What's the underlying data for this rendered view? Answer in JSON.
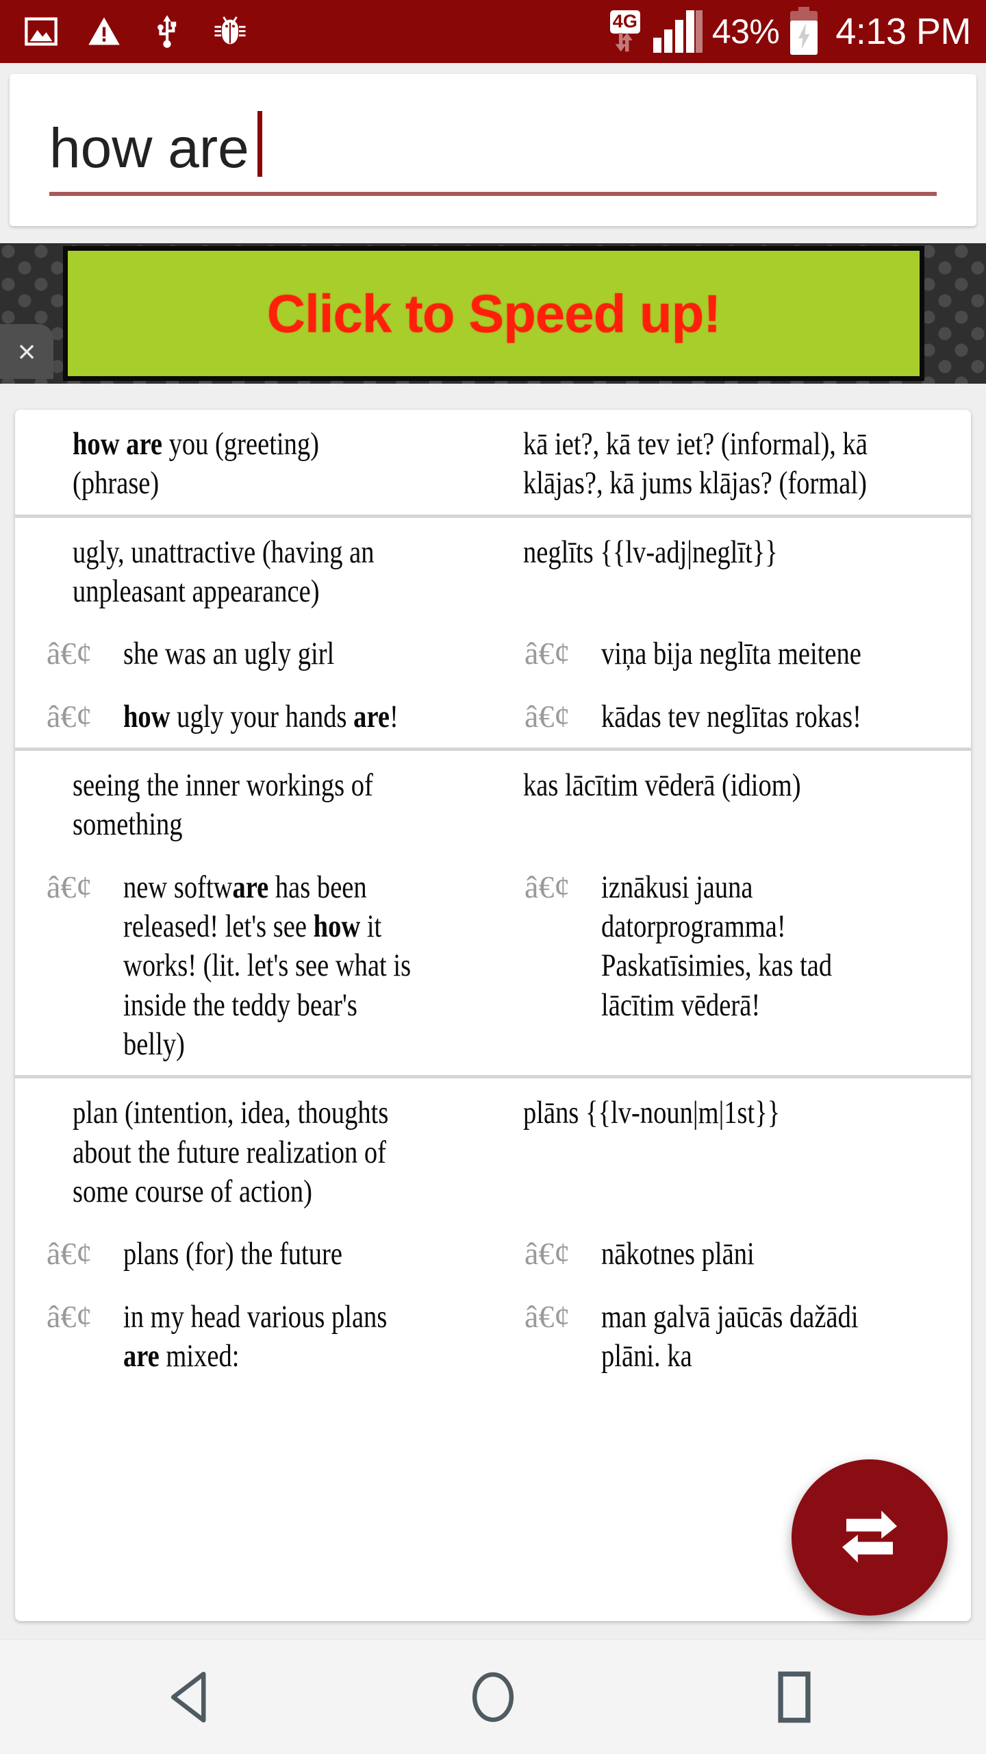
{
  "status_bar": {
    "background_color": "#8a0707",
    "left_icons": [
      "image-icon",
      "warning-triangle-icon",
      "usb-icon",
      "bug-icon"
    ],
    "network_type": "4G",
    "data_arrows_icon": "data-transfer-arrows-icon",
    "signal_icon": "signal-bars-icon",
    "battery_percent": "43%",
    "battery_icon": "battery-charging-icon",
    "clock": "4:13 PM"
  },
  "search": {
    "value": "how are",
    "placeholder": "",
    "caret_color": "#8a0707",
    "underline_color": "#a85a5a"
  },
  "ad": {
    "text": "Click to Speed up!",
    "text_color": "#ff1f0a",
    "background_color": "#a8ce2b",
    "close_label": "×"
  },
  "fab": {
    "icon": "swap-arrows-icon",
    "color": "#8a0d14"
  },
  "nav_bar": {
    "back_label": "back-triangle-icon",
    "home_label": "home-circle-icon",
    "recents_label": "recents-square-icon",
    "icon_color": "#4f5b62"
  },
  "results": [
    {
      "id": "entry-how-are-you",
      "head": {
        "source_html": "<b>how are</b> you (greeting) (phrase)",
        "target_html": "kā iet?, kā tev iet? (informal), kā klājas?, kā jums klājas? (formal)"
      },
      "examples": []
    },
    {
      "id": "entry-ugly",
      "head": {
        "source_html": "ugly, unattractive (having an unpleasant appearance)",
        "target_html": "neglīts {{lv-adj|neglīt}}"
      },
      "examples": [
        {
          "bullet": "â€¢",
          "source_html": "she was an ugly girl",
          "target_html": "viņa bija neglīta meitene"
        },
        {
          "bullet": "â€¢",
          "source_html": "<b>how</b> ugly your hands <b>are</b>!",
          "target_html": "kādas tev neglītas rokas!"
        }
      ]
    },
    {
      "id": "entry-inner-workings",
      "head": {
        "source_html": "seeing the inner workings of something",
        "target_html": "kas lācītim vēderā (idiom)"
      },
      "examples": [
        {
          "bullet": "â€¢",
          "source_html": "new softw<b>are</b> has been released! let's see <b>how</b> it works! (lit. let's see what is inside the teddy bear's belly)",
          "target_html": "iznākusi jauna datorprogramma! Paskatīsimies, kas tad lācītim vēderā!"
        }
      ]
    },
    {
      "id": "entry-plan",
      "head": {
        "source_html": "plan (intention, idea, thoughts about the future realization of some course of action)",
        "target_html": "plāns {{lv-noun|m|1st}}"
      },
      "examples": [
        {
          "bullet": "â€¢",
          "source_html": "plans (for) the future",
          "target_html": "nākotnes plāni"
        },
        {
          "bullet": "â€¢",
          "source_html": "in my head various plans <b>are</b> mixed:",
          "target_html": "man galvā jaūcās dažādi plāni. ka"
        }
      ]
    }
  ]
}
